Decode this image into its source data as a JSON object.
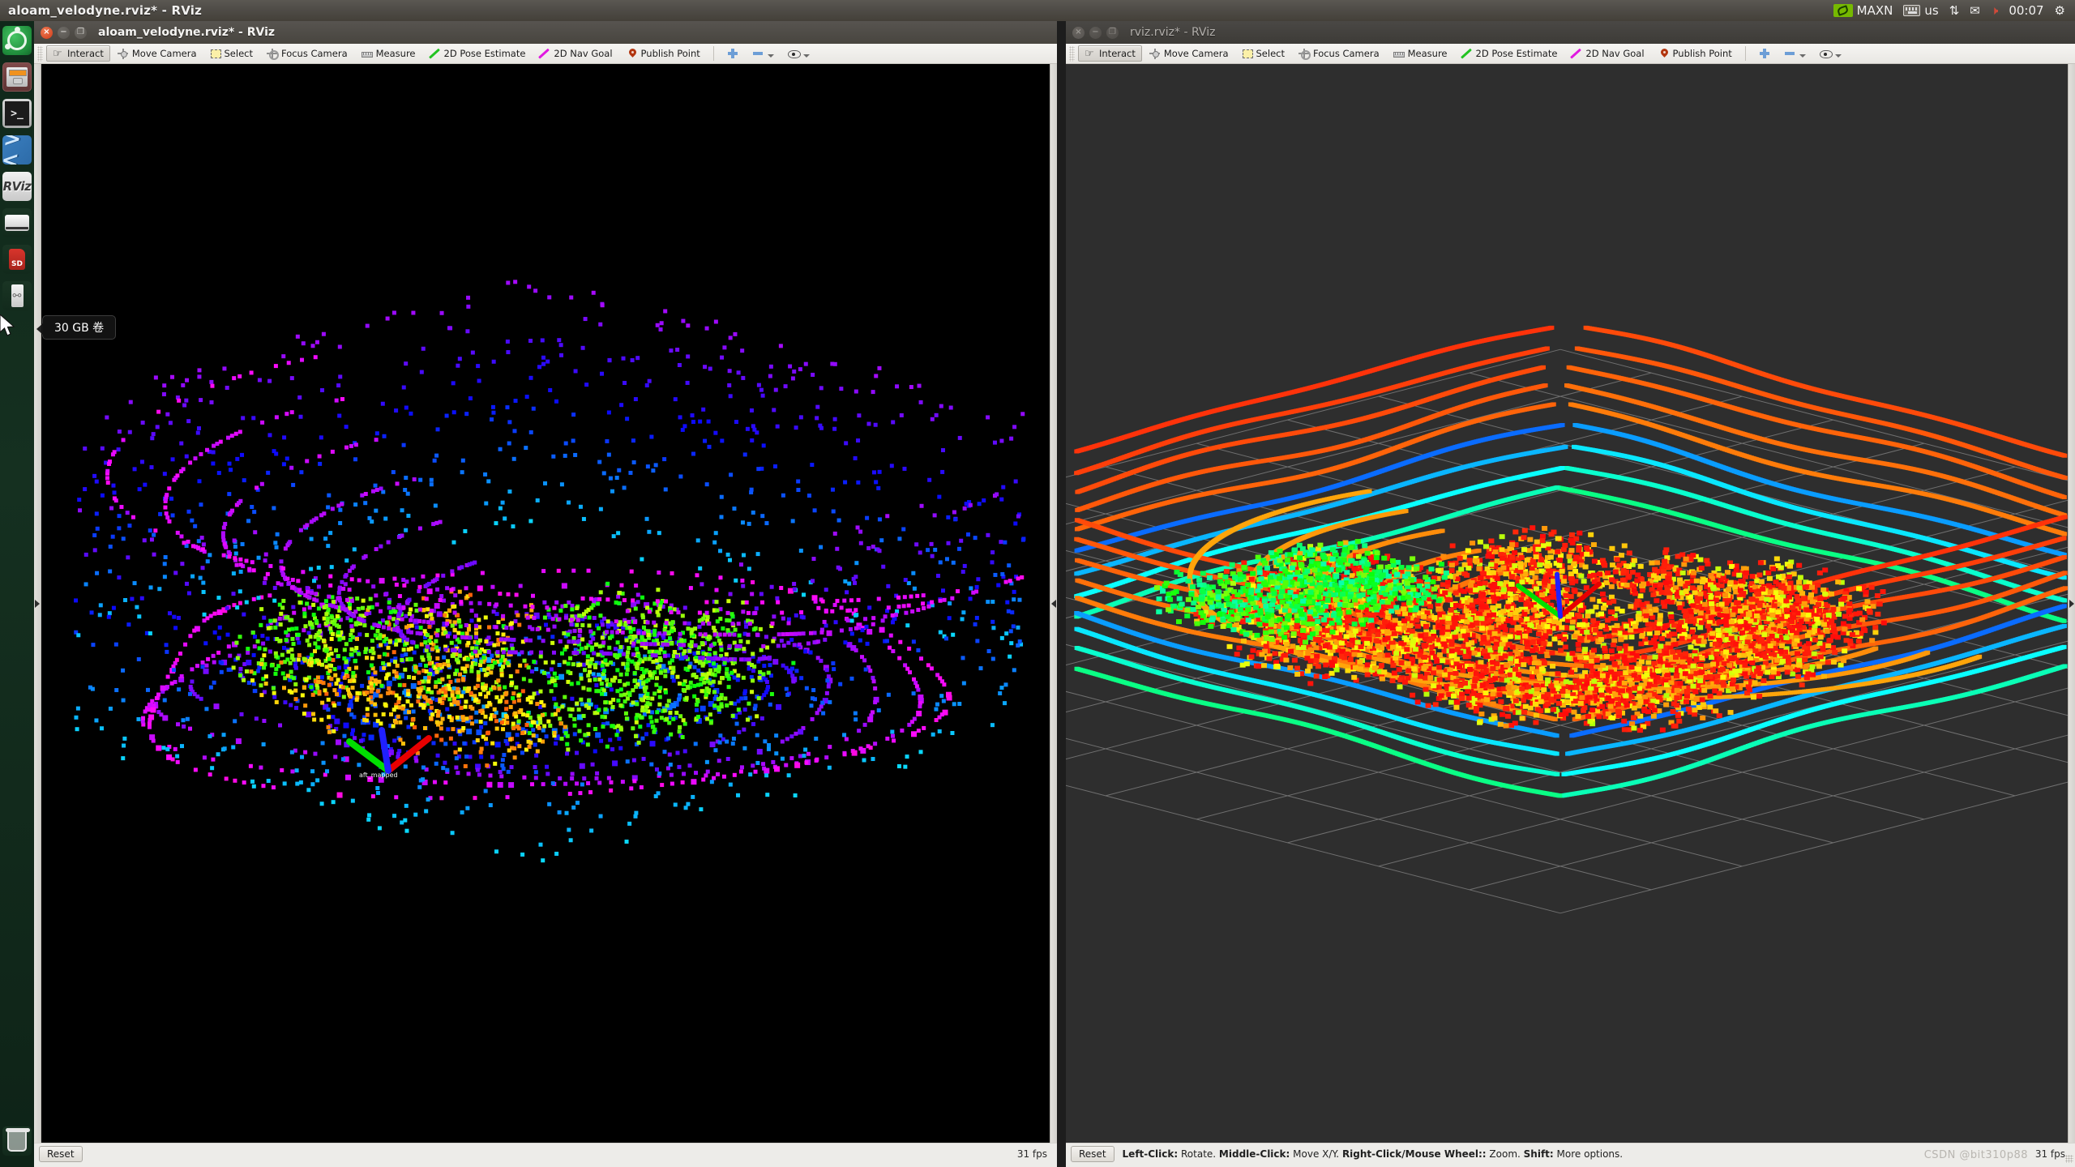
{
  "top_panel": {
    "title": "aloam_velodyne.rviz* - RViz",
    "tray": {
      "nvidia_label": "MAXN",
      "keyboard_layout": "us",
      "clock": "00:07",
      "icons": [
        "nvidia-icon",
        "keyboard-icon",
        "network-icon",
        "mail-icon",
        "volume-muted-icon",
        "gear-icon"
      ]
    }
  },
  "launcher": {
    "items": [
      {
        "name": "ubuntu-dash",
        "label": "Ubuntu"
      },
      {
        "name": "files",
        "label": "Files"
      },
      {
        "name": "terminal",
        "label": "Terminal"
      },
      {
        "name": "vscode",
        "label": "Visual Studio Code"
      },
      {
        "name": "rviz",
        "label": "RViz"
      },
      {
        "name": "drive",
        "label": "Drive"
      },
      {
        "name": "sd-card",
        "label": "SD"
      },
      {
        "name": "usb-drive",
        "label": "USB"
      },
      {
        "name": "trash",
        "label": "Trash"
      }
    ],
    "rviz_badge": "RViz",
    "sd_badge": "SD",
    "tooltip": "30 GB 卷"
  },
  "toolbar": {
    "buttons": [
      {
        "label": "Interact",
        "icon": "hand-icon",
        "active": true
      },
      {
        "label": "Move Camera",
        "icon": "move-camera-icon",
        "active": false
      },
      {
        "label": "Select",
        "icon": "select-icon",
        "active": false
      },
      {
        "label": "Focus Camera",
        "icon": "focus-camera-icon",
        "active": false
      },
      {
        "label": "Measure",
        "icon": "ruler-icon",
        "active": false
      },
      {
        "label": "2D Pose Estimate",
        "icon": "pose-arrow-icon",
        "active": false
      },
      {
        "label": "2D Nav Goal",
        "icon": "nav-goal-arrow-icon",
        "active": false
      },
      {
        "label": "Publish Point",
        "icon": "map-pin-icon",
        "active": false
      }
    ],
    "extras": [
      {
        "name": "add-tool-button",
        "icon": "plus-icon"
      },
      {
        "name": "remove-tool-button",
        "icon": "minus-icon"
      },
      {
        "name": "tool-visibility-button",
        "icon": "eye-icon"
      }
    ]
  },
  "window_left": {
    "title": "aloam_velodyne.rviz* - RViz",
    "active": true,
    "reset_label": "Reset",
    "fps": "31 fps",
    "status_hint": "",
    "viewport": {
      "background": "#000000",
      "kind": "point-cloud-sparse",
      "axes_label": "aft_mapped"
    }
  },
  "window_right": {
    "title": "rviz.rviz* - RViz",
    "active": false,
    "reset_label": "Reset",
    "fps": "31 fps",
    "status_hint_parts": [
      {
        "bold": "Left-Click:",
        "text": " Rotate. "
      },
      {
        "bold": "Middle-Click:",
        "text": " Move X/Y. "
      },
      {
        "bold": "Right-Click/Mouse Wheel::",
        "text": " Zoom. "
      },
      {
        "bold": "Shift:",
        "text": " More options."
      }
    ],
    "status_hint_plain": "Left-Click: Rotate. Middle-Click: Move X/Y. Right-Click/Mouse Wheel:: Zoom. Shift: More options.",
    "viewport": {
      "background": "#2e2e2e",
      "kind": "point-cloud-dense-map",
      "grid": true
    }
  },
  "watermark": "CSDN @bit310p88",
  "colors": {
    "panel_bg": "#4e4b46",
    "launcher_bg": "#153020",
    "chrome_bg": "#edece9",
    "toolbar_active": "#d3d0ca",
    "viewport_black": "#000000",
    "viewport_gray": "#2e2e2e",
    "nvidia_green": "#76b900",
    "accent_blue": "#6d9ed6",
    "pose_green": "#22c321",
    "nav_magenta": "#e01ae0",
    "pin_red": "#b2350f"
  }
}
